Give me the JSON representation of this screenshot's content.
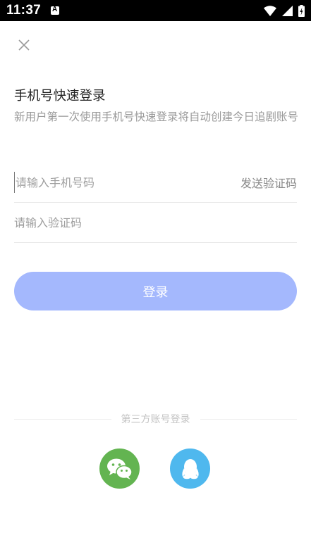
{
  "status_bar": {
    "time": "11:37"
  },
  "login": {
    "title": "手机号快速登录",
    "subtitle": "新用户第一次使用手机号快速登录将自动创建今日追剧账号",
    "phone_placeholder": "请输入手机号码",
    "send_code_label": "发送验证码",
    "code_placeholder": "请输入验证码",
    "login_button_label": "登录"
  },
  "third_party": {
    "label": "第三方账号登录"
  },
  "colors": {
    "accent": "#a4b8fd",
    "wechat": "#63b451",
    "qq": "#4fb8ee"
  }
}
